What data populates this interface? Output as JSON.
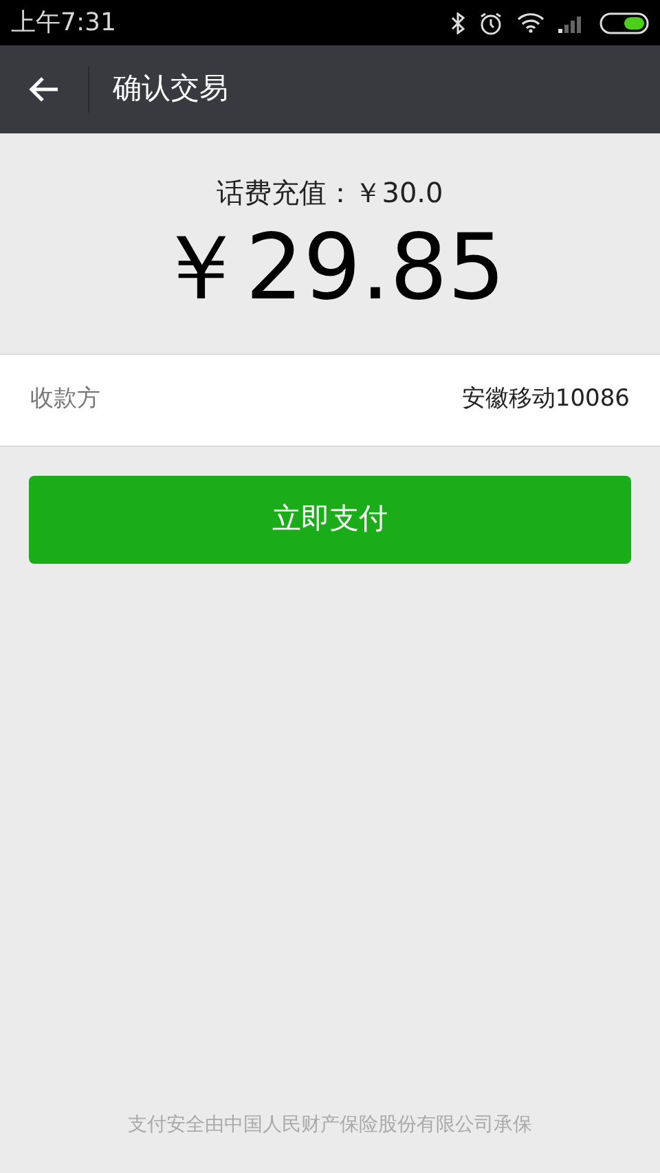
{
  "status_bar": {
    "time": "上午7:31"
  },
  "header": {
    "title": "确认交易"
  },
  "order": {
    "description": "话费充值：￥30.0",
    "amount": "￥29.85"
  },
  "payee": {
    "label": "收款方",
    "value": "安徽移动10086"
  },
  "pay_button": {
    "label": "立即支付"
  },
  "footer": {
    "text": "支付安全由中国人民财产保险股份有限公司承保"
  }
}
